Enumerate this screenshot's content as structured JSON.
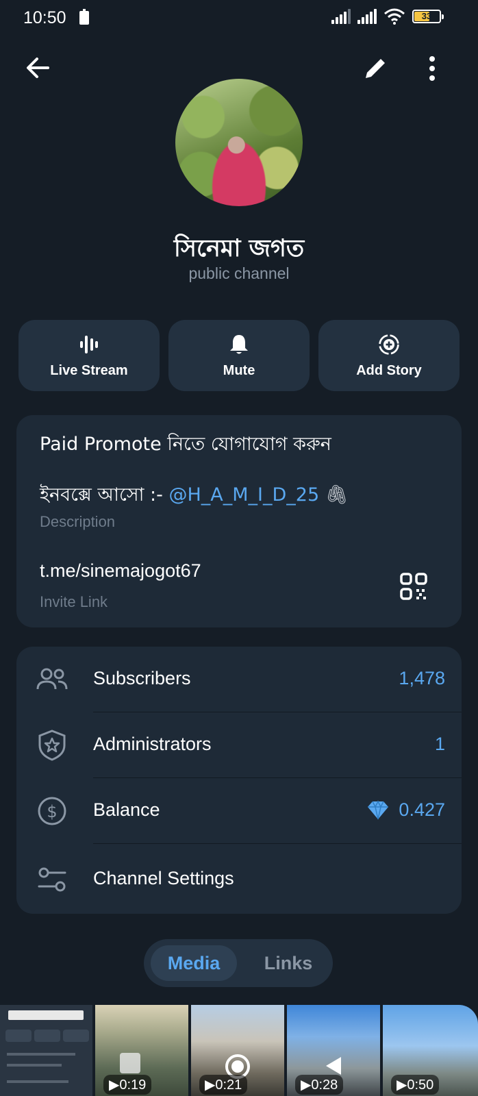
{
  "status_bar": {
    "time": "10:50",
    "battery": "33"
  },
  "channel": {
    "name": "সিনেমা জগত",
    "type": "public channel"
  },
  "actions": [
    {
      "label": "Live Stream",
      "icon": "live-stream-icon"
    },
    {
      "label": "Mute",
      "icon": "bell-icon"
    },
    {
      "label": "Add Story",
      "icon": "add-story-icon"
    }
  ],
  "info": {
    "description_line1": "Paid Promote নিতে যোগাযোগ করুন",
    "description_line2_prefix": "ইনবক্সে আসো :- ",
    "description_mention": "@H_A_M_I_D_25",
    "description_emoji": "🖇",
    "description_label": "Description",
    "invite_link": "t.me/sinemajogot67",
    "invite_label": "Invite Link"
  },
  "rows": [
    {
      "label": "Subscribers",
      "value": "1,478",
      "icon": "subscribers-icon"
    },
    {
      "label": "Administrators",
      "value": "1",
      "icon": "admin-shield-icon"
    },
    {
      "label": "Balance",
      "value": "0.427",
      "icon": "dollar-icon"
    },
    {
      "label": "Channel Settings",
      "value": "",
      "icon": "settings-sliders-icon"
    }
  ],
  "tabs": {
    "media": "Media",
    "links": "Links"
  },
  "media": [
    {
      "duration": ""
    },
    {
      "duration": "0:19"
    },
    {
      "duration": "0:21"
    },
    {
      "duration": "0:28"
    },
    {
      "duration": "0:50"
    }
  ],
  "colors": {
    "background": "#151d26",
    "card": "#1e2a37",
    "accent": "#5aa8f0",
    "muted": "#8b97a5"
  }
}
